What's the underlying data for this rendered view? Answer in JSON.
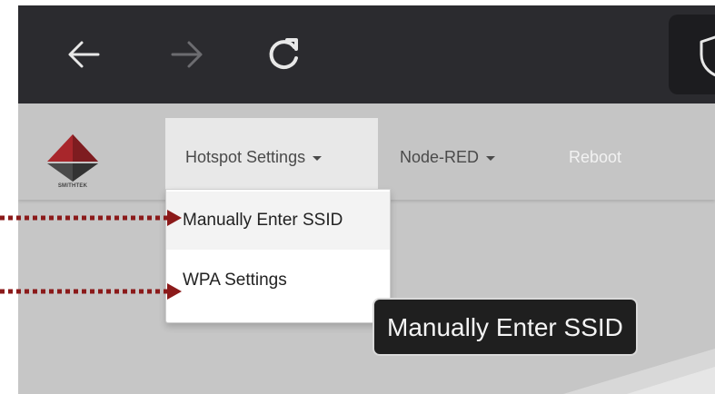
{
  "browser": {
    "back_icon": "arrow-left-icon",
    "forward_icon": "arrow-right-icon",
    "reload_icon": "reload-icon",
    "shield_icon": "shield-icon"
  },
  "site": {
    "logo_text": "SMITHTEK"
  },
  "navbar": {
    "items": [
      {
        "label": "Hotspot Settings",
        "has_caret": true
      },
      {
        "label": "Node-RED",
        "has_caret": true
      },
      {
        "label": "Reboot",
        "has_caret": false
      }
    ]
  },
  "dropdown": {
    "items": [
      {
        "label": "Manually Enter SSID"
      },
      {
        "label": "WPA Settings"
      }
    ]
  },
  "tooltip": {
    "text": "Manually Enter SSID"
  },
  "colors": {
    "toolbar": "#2b2b2f",
    "page_background": "#c6c6c6",
    "arrow_annotation": "#8b1a1a",
    "logo_red": "#a8262b"
  }
}
